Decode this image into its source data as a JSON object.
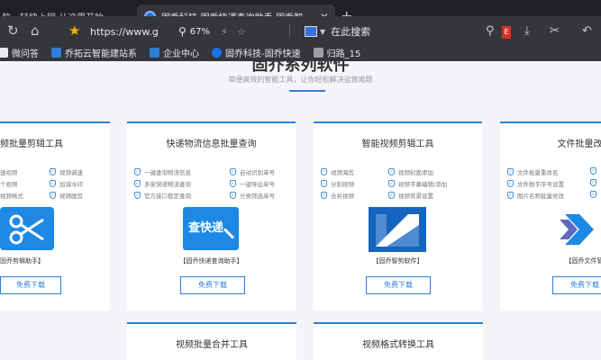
{
  "browser": {
    "tabs": [
      {
        "title": "航 - 轻快上网 从这里开始"
      },
      {
        "title": "固乔科技-固乔快递查询助手-固乔智"
      }
    ],
    "address": {
      "url": "https://www.g",
      "zoom": "67%"
    },
    "search": {
      "label": "在此搜索"
    },
    "bookmarks": [
      {
        "label": "微问答"
      },
      {
        "label": "乔拓云智能建站系"
      },
      {
        "label": "企业中心"
      },
      {
        "label": "固乔科技-固乔快速"
      },
      {
        "label": "归路_15"
      }
    ]
  },
  "page": {
    "heading": "固乔系列软件",
    "subheading": "简便高效的智能工具，让你轻松解决运营难题",
    "download_label": "免费下载",
    "cards": [
      {
        "title": "频批量剪辑工具",
        "features_left": [
          "速视频",
          "个视频",
          "视频格式"
        ],
        "features_right": [
          "视频调速",
          "加减水印",
          "视频画剪"
        ],
        "app_name": "固乔剪辑助手】"
      },
      {
        "title": "快递物流信息批量查询",
        "features_left": [
          "一键查询物流信息",
          "多家快递物流查询",
          "官方接口稳定查询"
        ],
        "features_right": [
          "自动识别单号",
          "一键导出单号",
          "分类筛选单号"
        ],
        "app_name": "【固乔快递查询助手】",
        "logo_text": "查快递"
      },
      {
        "title": "智能视频剪辑工具",
        "features_left": [
          "视频海剪",
          "分割视频",
          "合并视频"
        ],
        "features_right": [
          "视频封面添加",
          "视频字幕编辑/添加",
          "视频背景设置"
        ],
        "app_name": "【固乔智剪软件】"
      },
      {
        "title": "文件批量改名",
        "features_left": [
          "文件批量重命名",
          "文件数字序号设置",
          "图片名称批量修改"
        ],
        "features_right": [
          "",
          "",
          ""
        ],
        "app_name": "【固乔文件管"
      }
    ],
    "bottom_cards": [
      {
        "title": "视频批量合并工具"
      },
      {
        "title": "视频格式转换工具"
      }
    ]
  },
  "colors": {
    "accent": "#2f7ed8",
    "chrome_dark": "#202124",
    "chrome": "#35363a"
  }
}
